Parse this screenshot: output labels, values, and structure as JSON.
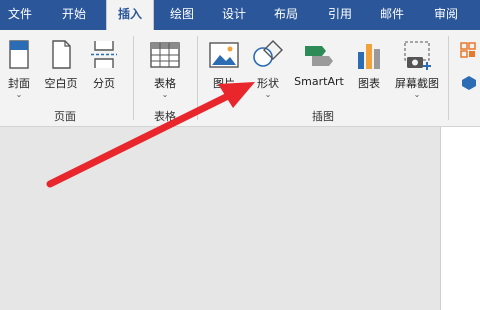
{
  "tabs": [
    {
      "label": "文件"
    },
    {
      "label": "开始"
    },
    {
      "label": "插入"
    },
    {
      "label": "绘图"
    },
    {
      "label": "设计"
    },
    {
      "label": "布局"
    },
    {
      "label": "引用"
    },
    {
      "label": "邮件"
    },
    {
      "label": "审阅"
    }
  ],
  "active_tab": "插入",
  "groups": {
    "pages": {
      "label": "页面",
      "buttons": {
        "cover": {
          "label": "封面",
          "dropdown": "⌄"
        },
        "blank_page": {
          "label": "空白页"
        },
        "page_break": {
          "label": "分页"
        }
      }
    },
    "tables": {
      "label": "表格",
      "buttons": {
        "table": {
          "label": "表格",
          "dropdown": "⌄"
        }
      }
    },
    "illustrations": {
      "label": "插图",
      "buttons": {
        "pictures": {
          "label": "图片",
          "dropdown": "⌄"
        },
        "shapes": {
          "label": "形状",
          "dropdown": "⌄"
        },
        "smartart": {
          "label": "SmartArt"
        },
        "chart": {
          "label": "图表"
        },
        "screenshot": {
          "label": "屏幕截图",
          "dropdown": "⌄"
        }
      }
    }
  },
  "colors": {
    "tab_bar": "#2b579a",
    "ribbon": "#f3f3f3",
    "annotation_arrow": "#e8262b"
  }
}
